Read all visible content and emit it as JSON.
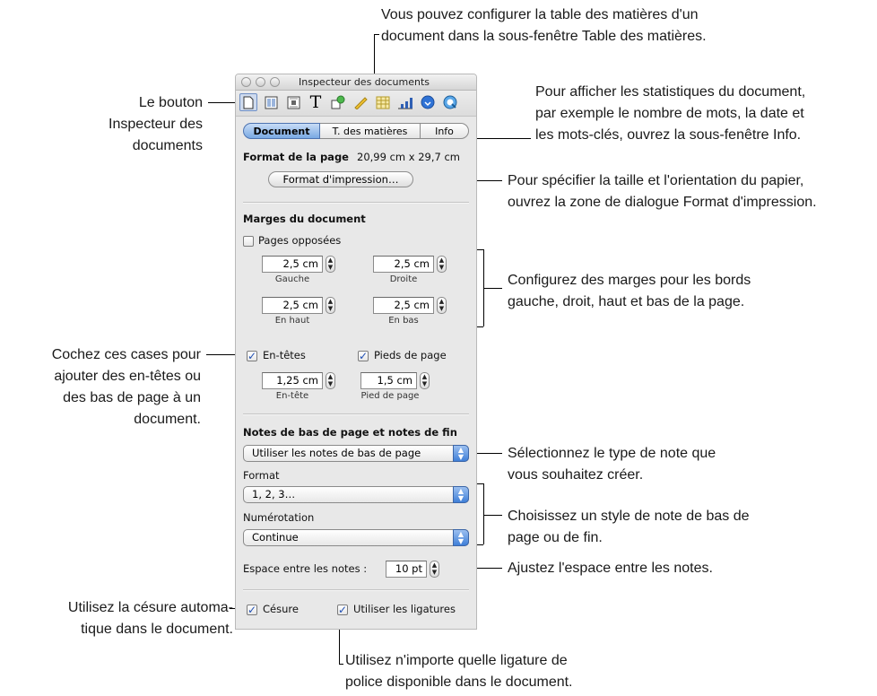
{
  "window": {
    "title": "Inspecteur des documents"
  },
  "toolbar": {
    "icons": [
      "document-icon",
      "layout-icon",
      "wrap-icon",
      "text-icon",
      "graphic-icon",
      "metrics-icon",
      "table-icon",
      "chart-icon",
      "link-icon",
      "quicktime-icon"
    ]
  },
  "tabs": [
    {
      "label": "Document",
      "selected": true
    },
    {
      "label": "T. des matières",
      "selected": false
    },
    {
      "label": "Info",
      "selected": false
    }
  ],
  "page_format": {
    "label": "Format de la page",
    "value": "20,99 cm x 29,7 cm",
    "button": "Format d'impression…"
  },
  "margins": {
    "heading": "Marges du document",
    "facing_pages": {
      "label": "Pages opposées",
      "checked": false
    },
    "left": {
      "value": "2,5 cm",
      "label": "Gauche"
    },
    "right": {
      "value": "2,5 cm",
      "label": "Droite"
    },
    "top": {
      "value": "2,5 cm",
      "label": "En haut"
    },
    "bottom": {
      "value": "2,5 cm",
      "label": "En bas"
    }
  },
  "headers_footers": {
    "headers": {
      "label": "En-têtes",
      "checked": true
    },
    "footers": {
      "label": "Pieds de page",
      "checked": true
    },
    "header": {
      "value": "1,25 cm",
      "label": "En-tête"
    },
    "footer": {
      "value": "1,5 cm",
      "label": "Pied de page"
    }
  },
  "notes": {
    "heading": "Notes de bas de page et notes de fin",
    "type_value": "Utiliser les notes de bas de page",
    "format_label": "Format",
    "format_value": "1, 2, 3…",
    "numbering_label": "Numérotation",
    "numbering_value": "Continue",
    "spacing_label": "Espace entre les notes :",
    "spacing_value": "10 pt"
  },
  "bottom": {
    "hyphenation": {
      "label": "Césure",
      "checked": true
    },
    "ligatures": {
      "label": "Utiliser les ligatures",
      "checked": true
    }
  },
  "callouts": {
    "top_line1": "Vous pouvez configurer la table des matières d'un",
    "top_line2": "document dans la sous-fenêtre Table des matières.",
    "inspector_button_line1": "Le bouton",
    "inspector_button_line2": "Inspecteur des",
    "inspector_button_line3": "documents",
    "info_line1": "Pour afficher les statistiques du document,",
    "info_line2": "par exemple le nombre de mots, la date et",
    "info_line3": "les mots-clés, ouvrez la sous-fenêtre Info.",
    "print_line1": "Pour spécifier la taille et l'orientation du papier,",
    "print_line2": "ouvrez la zone de dialogue Format d'impression.",
    "margins_line1": "Configurez des marges pour les bords",
    "margins_line2": "gauche, droit, haut et bas de la page.",
    "headers_line1": "Cochez ces cases pour",
    "headers_line2": "ajouter des en-têtes ou",
    "headers_line3": "des bas de page à un",
    "headers_line4": "document.",
    "note_type_line1": "Sélectionnez le type de note que",
    "note_type_line2": "vous souhaitez créer.",
    "note_style_line1": "Choisissez un style de note de bas de",
    "note_style_line2": "page ou de fin.",
    "spacing_line1": "Ajustez l'espace entre les notes.",
    "hyphen_line1": "Utilisez la césure automa-",
    "hyphen_line2": "tique dans le document.",
    "ligature_line1": "Utilisez n'importe quelle ligature de",
    "ligature_line2": "police disponible dans le document."
  }
}
